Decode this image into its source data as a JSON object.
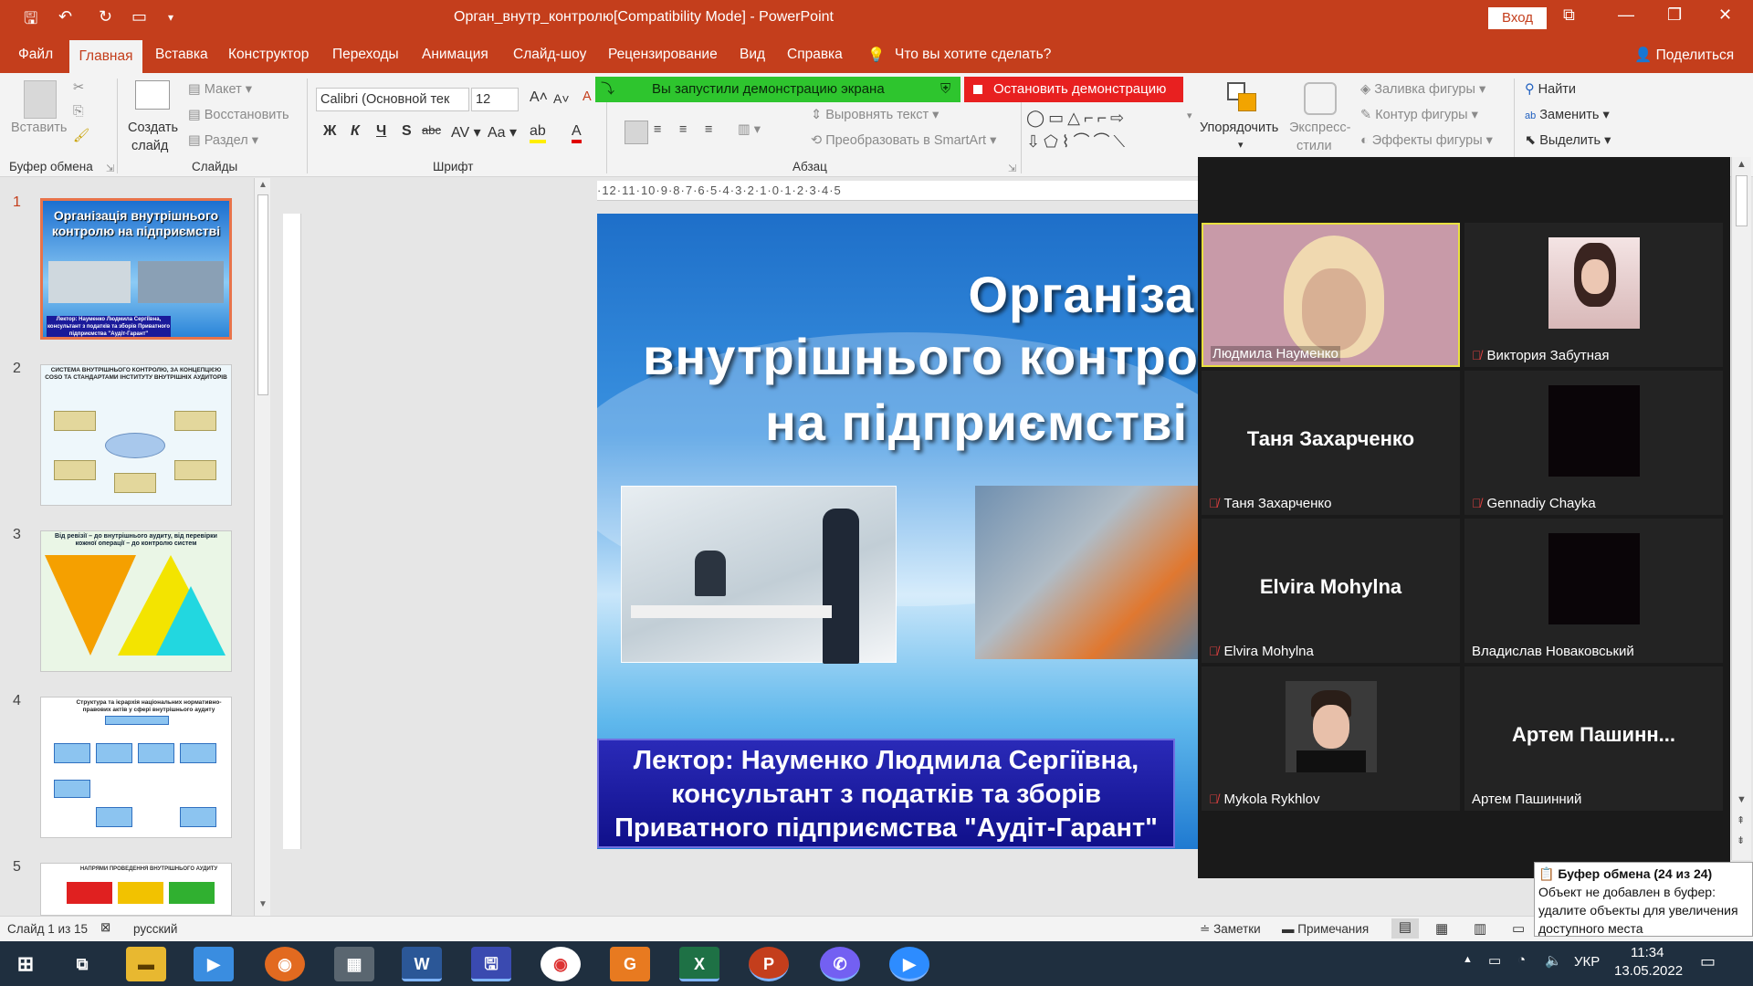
{
  "titlebar": {
    "title": "Орган_внутр_контролю[Compatibility Mode]  -  PowerPoint",
    "login": "Вход"
  },
  "tabs": {
    "file": "Файл",
    "home": "Главная",
    "insert": "Вставка",
    "design": "Конструктор",
    "transitions": "Переходы",
    "animation": "Анимация",
    "slideshow": "Слайд-шоу",
    "review": "Рецензирование",
    "view": "Вид",
    "help": "Справка",
    "tell": "Что вы хотите сделать?",
    "share": "Поделиться"
  },
  "ribbon": {
    "clipboard": {
      "paste": "Вставить",
      "group": "Буфер обмена"
    },
    "slides": {
      "new_slide_1": "Создать",
      "new_slide_2": "слайд",
      "layout": "Макет",
      "reset": "Восстановить",
      "section": "Раздел",
      "group": "Слайды"
    },
    "font": {
      "name": "Calibri (Основной тек",
      "size": "12",
      "group": "Шрифт",
      "bold": "Ж",
      "italic": "К",
      "underline": "Ч",
      "strike": "S",
      "abc": "abc"
    },
    "paragraph": {
      "align_text": "Выровнять текст",
      "smartart": "Преобразовать в SmartArt",
      "group": "Абзац"
    },
    "drawing": {
      "arrange_1": "Упорядочить",
      "quick_1": "Экспресс-",
      "quick_2": "стили",
      "fill": "Заливка фигуры",
      "outline": "Контур фигуры",
      "effects": "Эффекты фигуры"
    },
    "editing": {
      "find": "Найти",
      "replace": "Заменить",
      "select": "Выделить"
    }
  },
  "share_banner": {
    "status": "Вы запустили демонстрацию экрана",
    "stop": "Остановить демонстрацию"
  },
  "thumbnails": [
    {
      "num": "1",
      "title": "Організація внутрішнього контролю на підприємстві",
      "caption": "Лектор: Науменко Людмила Сергіївна, консультант з податків та зборів Приватного підприємства \"Аудіт-Гарант\""
    },
    {
      "num": "2",
      "title": "СИСТЕМА ВНУТРІШНЬОГО КОНТРОЛЮ, ЗА КОНЦЕПЦІЄЮ COSO ТА СТАНДАРТАМИ ІНСТИТУТУ ВНУТРІШНІХ АУДИТОРІВ"
    },
    {
      "num": "3",
      "title": "Від ревізії – до внутрішнього аудиту, від перевірки кожної операції – до контролю систем"
    },
    {
      "num": "4",
      "title": "Структура та ієрархія національних нормативно-правових актів у сфері внутрішнього аудиту"
    },
    {
      "num": "5",
      "title": "НАПРЯМИ ПРОВЕДЕННЯ ВНУТРІШНЬОГО АУДИТУ"
    }
  ],
  "ruler": {
    "marks": "·12·11·10·9·8·7·6·5·4·3·2·1·0·1·2·3·4·5"
  },
  "slide": {
    "title_1": "Організація",
    "title_2": "внутрішнього контролю",
    "title_3": "на підприємстві",
    "lecturer_1": "Лектор: Науменко Людмила Сергіївна,",
    "lecturer_2": "консультант з податків та зборів",
    "lecturer_3": "Приватного підприємства \"Аудіт-Гарант\""
  },
  "zoom": {
    "tiles": [
      {
        "name": "Людмила Науменко",
        "big": "",
        "muted": false
      },
      {
        "name": "Виктория Забутная",
        "big": "",
        "muted": true
      },
      {
        "name": "Таня Захарченко",
        "big": "Таня Захарченко",
        "muted": true
      },
      {
        "name": "Gennadiy Chayka",
        "big": "",
        "muted": true
      },
      {
        "name": "Elvira Mohylna",
        "big": "Elvira Mohylna",
        "muted": true
      },
      {
        "name": "Владислав Новаковський",
        "big": "",
        "muted": false
      },
      {
        "name": "Mykola Rykhlov",
        "big": "",
        "muted": true
      },
      {
        "name": "Артем Пашинний",
        "big": "Артем  Пашинн...",
        "muted": false
      }
    ]
  },
  "status": {
    "slide": "Слайд 1 из 15",
    "lang": "русский",
    "notes": "Заметки",
    "comments": "Примечания"
  },
  "clipboard_tip": {
    "title": "Буфер обмена (24 из 24)",
    "line1": "Объект не добавлен в буфер:",
    "line2": "удалите объекты для увеличения",
    "line3": "доступного места"
  },
  "taskbar": {
    "lang": "УКР",
    "time": "11:34",
    "date": "13.05.2022"
  },
  "colors": {
    "accent": "#c43e1c",
    "share_green": "#2ec52e",
    "stop_red": "#e82020",
    "zoom_bg": "#1a1a1a"
  }
}
